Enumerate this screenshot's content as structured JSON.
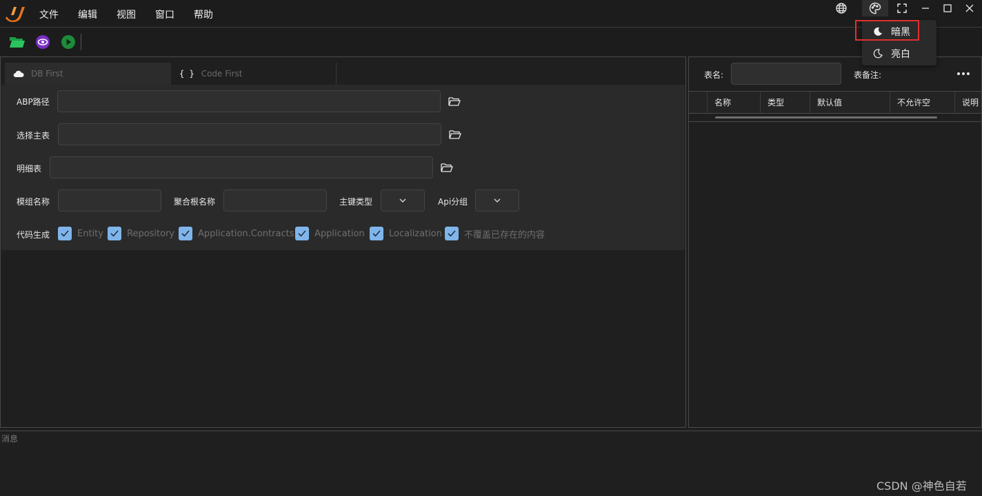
{
  "menu": {
    "file": "文件",
    "edit": "编辑",
    "view": "视图",
    "window": "窗口",
    "help": "帮助"
  },
  "theme_menu": {
    "dark": "暗黑",
    "light": "亮白"
  },
  "tabs": [
    {
      "label": "DB First",
      "icon": "cloud-icon"
    },
    {
      "label": "Code First",
      "icon": "braces-icon"
    }
  ],
  "form": {
    "abp_path_label": "ABP路径",
    "main_table_label": "选择主表",
    "detail_table_label": "明细表",
    "module_name_label": "模组名称",
    "aggregate_root_label": "聚合根名称",
    "key_type_label": "主键类型",
    "api_group_label": "Api分组",
    "codegen_label": "代码生成",
    "checkboxes": [
      "Entity",
      "Repository",
      "Application.Contracts",
      "Application",
      "Localization",
      "不覆盖已存在的内容"
    ]
  },
  "right": {
    "table_name_label": "表名:",
    "table_comment_label": "表备注:",
    "columns": [
      "名称",
      "类型",
      "默认值",
      "不允许空",
      "说明"
    ]
  },
  "messages": {
    "label": "消息"
  },
  "watermark": "CSDN @神色自若",
  "colors": {
    "accent_check": "#7fb5ea",
    "highlight": "#e0302f",
    "logo": "#e8741f"
  }
}
